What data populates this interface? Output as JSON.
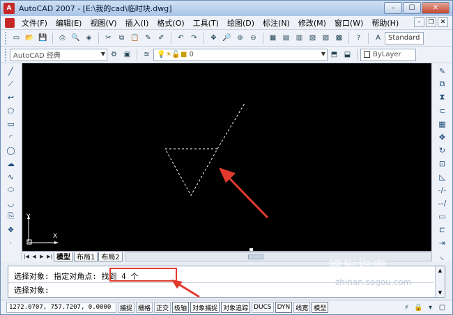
{
  "window": {
    "title": "AutoCAD 2007 - [E:\\我的cad\\临时块.dwg]",
    "app_icon": "A",
    "controls": [
      "minimize-icon",
      "maximize-icon",
      "close-icon"
    ]
  },
  "menu": {
    "items": [
      {
        "label": "文件(F)"
      },
      {
        "label": "编辑(E)"
      },
      {
        "label": "视图(V)"
      },
      {
        "label": "插入(I)"
      },
      {
        "label": "格式(O)"
      },
      {
        "label": "工具(T)"
      },
      {
        "label": "绘图(D)"
      },
      {
        "label": "标注(N)"
      },
      {
        "label": "修改(M)"
      },
      {
        "label": "窗口(W)"
      },
      {
        "label": "帮助(H)"
      }
    ]
  },
  "toolbar_standard": {
    "text_style": "Standard"
  },
  "toolbar_workspace": {
    "workspace": "AutoCAD 经典",
    "layer": "0",
    "color": "ByLayer"
  },
  "left_tools": [
    "line-icon",
    "construction-line-icon",
    "polyline-icon",
    "polygon-icon",
    "rectangle-icon",
    "arc-icon",
    "circle-icon",
    "revision-cloud-icon",
    "spline-icon",
    "ellipse-icon",
    "ellipse-arc-icon",
    "insert-block-icon",
    "make-block-icon",
    "point-icon",
    "hatch-icon"
  ],
  "right_tools": [
    "erase-icon",
    "copy-icon",
    "mirror-icon",
    "offset-icon",
    "array-icon",
    "move-icon",
    "rotate-icon",
    "scale-icon",
    "stretch-icon",
    "trim-icon",
    "extend-icon",
    "break-icon",
    "join-icon",
    "chamfer-icon",
    "fillet-icon",
    "explode-icon"
  ],
  "drawing": {
    "ucs_x": "X",
    "ucs_y": "Y"
  },
  "layout_tabs": [
    {
      "label": "模型",
      "active": true
    },
    {
      "label": "布局1",
      "active": false
    },
    {
      "label": "布局2",
      "active": false
    }
  ],
  "command": {
    "line1": "选择对象: 指定对角点: 找到 4 个",
    "line2": "选择对象:"
  },
  "status": {
    "coords": "1272.0707, 757.7207, 0.0000",
    "toggles": [
      {
        "label": "捕捉",
        "on": false
      },
      {
        "label": "栅格",
        "on": false
      },
      {
        "label": "正交",
        "on": false
      },
      {
        "label": "极轴",
        "on": true
      },
      {
        "label": "对象捕捉",
        "on": true
      },
      {
        "label": "对象追踪",
        "on": true
      },
      {
        "label": "DUCS",
        "on": false
      },
      {
        "label": "DYN",
        "on": true
      },
      {
        "label": "线宽",
        "on": false
      },
      {
        "label": "模型",
        "on": true
      }
    ]
  },
  "watermark": "搜狗指南",
  "watermark_url": "zhinan.sogou.com",
  "colors": {
    "selection_highlight": "#e23a2e",
    "canvas_bg": "#000000"
  }
}
